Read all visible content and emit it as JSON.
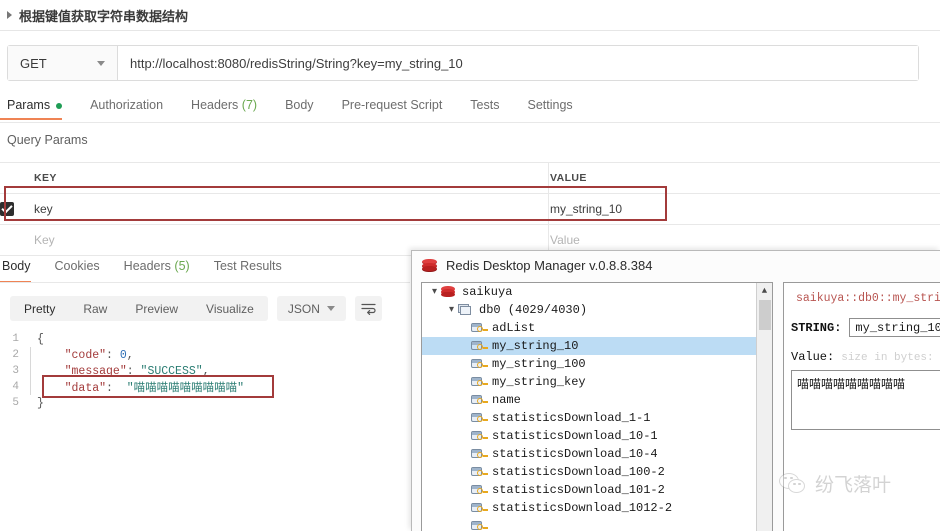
{
  "page": {
    "title": "根据键值获取字符串数据结构"
  },
  "request": {
    "method": "GET",
    "url": "http://localhost:8080/redisString/String?key=my_string_10",
    "tabs": [
      {
        "label": "Params",
        "badge": "dot",
        "active": true
      },
      {
        "label": "Authorization",
        "badge": "",
        "active": false
      },
      {
        "label": "Headers",
        "count": "(7)",
        "active": false
      },
      {
        "label": "Body",
        "badge": "",
        "active": false
      },
      {
        "label": "Pre-request Script",
        "badge": "",
        "active": false
      },
      {
        "label": "Tests",
        "badge": "",
        "active": false
      },
      {
        "label": "Settings",
        "badge": "",
        "active": false
      }
    ],
    "query_params": {
      "section_label": "Query Params",
      "headers": {
        "key": "KEY",
        "value": "VALUE"
      },
      "rows": [
        {
          "checked": true,
          "key": "key",
          "value": "my_string_10"
        },
        {
          "checked": false,
          "key_placeholder": "Key",
          "value_placeholder": "Value"
        }
      ]
    }
  },
  "response": {
    "tabs": [
      {
        "label": "Body",
        "active": true
      },
      {
        "label": "Cookies",
        "active": false
      },
      {
        "label": "Headers",
        "count": "(5)",
        "active": false
      },
      {
        "label": "Test Results",
        "active": false
      }
    ],
    "format_tabs": [
      {
        "label": "Pretty",
        "active": true
      },
      {
        "label": "Raw",
        "active": false
      },
      {
        "label": "Preview",
        "active": false
      },
      {
        "label": "Visualize",
        "active": false
      }
    ],
    "content_type": "JSON",
    "body_lines": [
      {
        "n": "1",
        "text": "{"
      },
      {
        "n": "2",
        "key": "\"code\"",
        "sep": ": ",
        "num": "0",
        "tail": ","
      },
      {
        "n": "3",
        "key": "\"message\"",
        "sep": ": ",
        "str": "\"SUCCESS\"",
        "tail": ","
      },
      {
        "n": "4",
        "key": "\"data\"",
        "sep": ":  ",
        "str": "\"喵喵喵喵喵喵喵喵喵\"",
        "tail": ""
      },
      {
        "n": "5",
        "text": "}"
      }
    ]
  },
  "redis": {
    "window_title": "Redis Desktop Manager v.0.8.8.384",
    "tree": [
      {
        "label": "saikuya",
        "depth": 0,
        "icon": "redis-icon",
        "chevron": "v",
        "selected": false
      },
      {
        "label": "db0   (4029/4030)",
        "depth": 1,
        "icon": "db-icon",
        "chevron": "v",
        "selected": false
      },
      {
        "label": "adList",
        "depth": 2,
        "icon": "key-icon",
        "chevron": "",
        "selected": false
      },
      {
        "label": "my_string_10",
        "depth": 2,
        "icon": "key-icon",
        "chevron": "",
        "selected": true
      },
      {
        "label": "my_string_100",
        "depth": 2,
        "icon": "key-icon",
        "chevron": "",
        "selected": false
      },
      {
        "label": "my_string_key",
        "depth": 2,
        "icon": "key-icon",
        "chevron": "",
        "selected": false
      },
      {
        "label": "name",
        "depth": 2,
        "icon": "key-icon",
        "chevron": "",
        "selected": false
      },
      {
        "label": "statisticsDownload_1-1",
        "depth": 2,
        "icon": "key-icon",
        "chevron": "",
        "selected": false
      },
      {
        "label": "statisticsDownload_10-1",
        "depth": 2,
        "icon": "key-icon",
        "chevron": "",
        "selected": false
      },
      {
        "label": "statisticsDownload_10-4",
        "depth": 2,
        "icon": "key-icon",
        "chevron": "",
        "selected": false
      },
      {
        "label": "statisticsDownload_100-2",
        "depth": 2,
        "icon": "key-icon",
        "chevron": "",
        "selected": false
      },
      {
        "label": "statisticsDownload_101-2",
        "depth": 2,
        "icon": "key-icon",
        "chevron": "",
        "selected": false
      },
      {
        "label": "statisticsDownload_1012-2",
        "depth": 2,
        "icon": "key-icon",
        "chevron": "",
        "selected": false
      }
    ],
    "detail": {
      "path": "saikuya::db0::my_stri",
      "type_label": "STRING:",
      "key_value": "my_string_10",
      "value_label": "Value:",
      "value_hint": "size in bytes:",
      "value_text": "喵喵喵喵喵喵喵喵喵"
    }
  },
  "watermark": {
    "text": "纷飞落叶"
  },
  "colors": {
    "accent": "#ef8354",
    "highlight_box": "#a33b3b",
    "json_key": "#a33b3b",
    "json_string": "#2b7d73",
    "json_number": "#2f6fb5",
    "selection": "#bcdcf4",
    "redis_red": "#cf2c2c",
    "param_dot": "#1f9d55"
  }
}
